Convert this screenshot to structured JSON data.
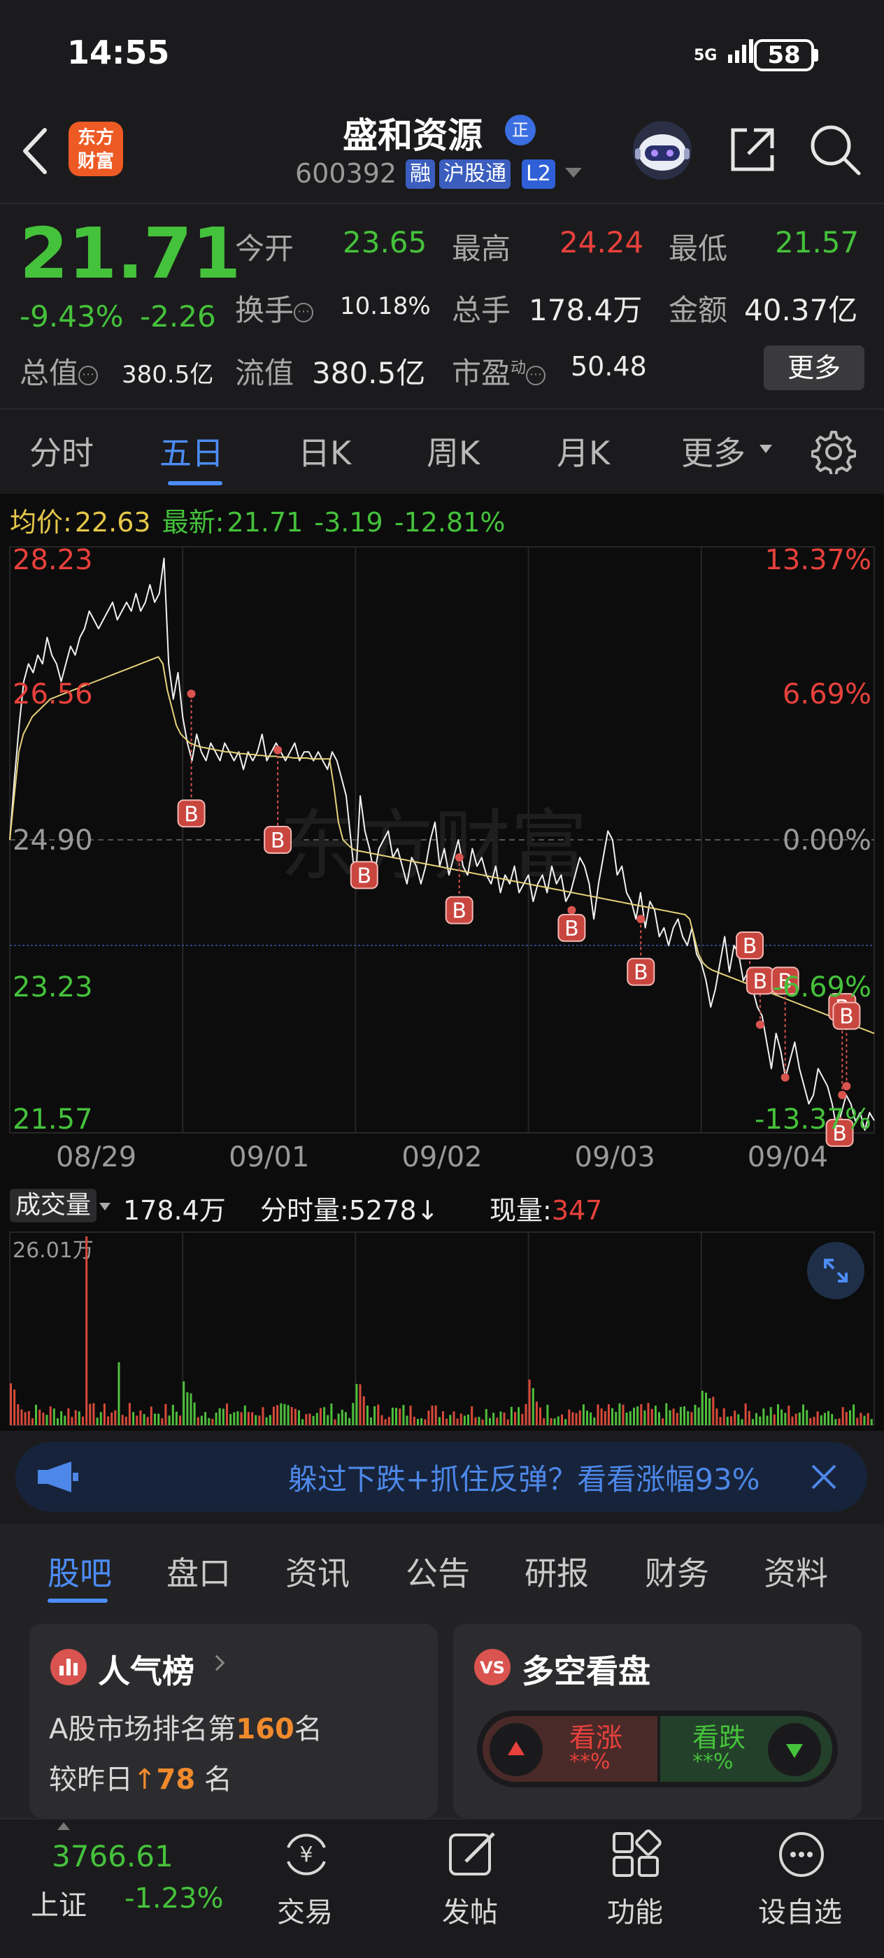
{
  "status_bar": {
    "time": "14:55",
    "network": "5G",
    "battery": "58"
  },
  "header": {
    "logo_line1": "东方",
    "logo_line2": "财富",
    "stock_name": "盛和资源",
    "name_badge": "正",
    "stock_code": "600392",
    "tags": [
      "融",
      "沪股通",
      "L2"
    ]
  },
  "quote": {
    "price": "21.71",
    "change_pct": "-9.43%",
    "change_val": "-2.26",
    "fields": {
      "open_label": "今开",
      "open": "23.65",
      "high_label": "最高",
      "high": "24.24",
      "low_label": "最低",
      "low": "21.57",
      "turnover_label": "换手",
      "turnover": "10.18%",
      "volume_label": "总手",
      "volume": "178.4万",
      "amount_label": "金额",
      "amount": "40.37亿",
      "mktcap_label": "总值",
      "mktcap": "380.5亿",
      "float_label": "流值",
      "float": "380.5亿",
      "pe_label": "市盈",
      "pe_sup": "动",
      "pe": "50.48"
    },
    "more_button": "更多"
  },
  "chart_tabs": [
    "分时",
    "五日",
    "日K",
    "周K",
    "月K",
    "更多"
  ],
  "active_tab": "五日",
  "info_line": {
    "avg_label": "均价:",
    "avg": "22.63",
    "latest_label": "最新:",
    "latest": "21.71",
    "change": "-3.19",
    "change_pct": "-12.81%"
  },
  "chart_data": {
    "type": "line",
    "watermark": "东方财富",
    "y_ticks_left": [
      "28.23",
      "26.56",
      "24.90",
      "23.23",
      "21.57"
    ],
    "y_ticks_right": [
      "13.37%",
      "6.69%",
      "0.00%",
      "-6.69%",
      "-13.37%"
    ],
    "ylim": [
      21.57,
      28.23
    ],
    "prev_close": 24.9,
    "x_labels": [
      "08/29",
      "09/01",
      "09/02",
      "09/03",
      "09/04"
    ],
    "series": [
      {
        "values": [
          24.9,
          25.6,
          26.2,
          26.7,
          26.9,
          26.8,
          27.0,
          26.9,
          27.2,
          27.0,
          26.9,
          26.7,
          26.9,
          27.1,
          27.0,
          27.2,
          27.3,
          27.5,
          27.4,
          27.3,
          27.4,
          27.5,
          27.6,
          27.4,
          27.5,
          27.6,
          27.5,
          27.7,
          27.5,
          27.6,
          27.8,
          27.6,
          27.7,
          28.1,
          26.9,
          26.5,
          26.8,
          26.3,
          26.0,
          25.8,
          26.1,
          25.9,
          25.8,
          26.0,
          25.9,
          25.8,
          26.0,
          25.9,
          25.8,
          25.9,
          25.7,
          25.9,
          25.8,
          25.9,
          26.1,
          25.8,
          25.9,
          26.0,
          25.9,
          25.8,
          25.9,
          26.0,
          25.8,
          25.9,
          25.9,
          25.8,
          25.9,
          25.8,
          25.7,
          25.9,
          25.8,
          25.6,
          25.4,
          24.9,
          24.4,
          25.4,
          25.0,
          24.8,
          24.5,
          24.8,
          24.9,
          25.0,
          24.7,
          24.8,
          24.6,
          24.4,
          24.7,
          24.6,
          24.4,
          24.6,
          24.9,
          25.1,
          24.6,
          24.8,
          24.5,
          24.7,
          24.9,
          24.6,
          24.5,
          24.8,
          24.6,
          24.7,
          24.5,
          24.4,
          24.6,
          24.3,
          24.5,
          24.4,
          24.6,
          24.3,
          24.4,
          24.5,
          24.2,
          24.4,
          24.5,
          24.3,
          24.6,
          24.4,
          24.5,
          24.2,
          24.3,
          24.5,
          24.7,
          24.6,
          24.4,
          24.0,
          24.4,
          24.7,
          25.0,
          24.9,
          24.5,
          24.6,
          24.3,
          24.2,
          24.0,
          24.3,
          23.9,
          24.2,
          24.1,
          23.8,
          23.9,
          23.7,
          23.9,
          24.0,
          23.8,
          23.7,
          23.9,
          23.6,
          23.5,
          23.3,
          23.0,
          23.2,
          23.5,
          23.8,
          23.4,
          23.7,
          23.6,
          23.3,
          23.4,
          23.2,
          23.0,
          22.9,
          22.6,
          22.3,
          22.7,
          22.5,
          22.2,
          22.4,
          22.6,
          22.3,
          22.1,
          21.9,
          22.0,
          22.3,
          22.2,
          22.1,
          21.9,
          21.6,
          21.8,
          22.0,
          21.9,
          21.7,
          21.8,
          21.6,
          21.8,
          21.71
        ]
      },
      {
        "name": "均价",
        "values": [
          24.9,
          25.4,
          25.9,
          26.1,
          26.2,
          26.3,
          26.35,
          26.4,
          26.45,
          26.5,
          26.52,
          26.54,
          26.56,
          26.58,
          26.6,
          26.62,
          26.64,
          26.66,
          26.68,
          26.7,
          26.72,
          26.74,
          26.76,
          26.78,
          26.8,
          26.82,
          26.84,
          26.86,
          26.88,
          26.9,
          26.92,
          26.94,
          26.96,
          26.98,
          26.9,
          26.6,
          26.4,
          26.2,
          26.1,
          26.05,
          26.0,
          25.98,
          25.96,
          25.95,
          25.94,
          25.93,
          25.92,
          25.91,
          25.9,
          25.9,
          25.89,
          25.88,
          25.88,
          25.87,
          25.87,
          25.86,
          25.86,
          25.85,
          25.85,
          25.85,
          25.84,
          25.84,
          25.84,
          25.83,
          25.83,
          25.83,
          25.83,
          25.82,
          25.82,
          25.82,
          25.82,
          25.82,
          25.5,
          25.1,
          24.9,
          24.85,
          24.8,
          24.78,
          24.77,
          24.76,
          24.75,
          24.74,
          24.73,
          24.72,
          24.71,
          24.7,
          24.69,
          24.68,
          24.67,
          24.66,
          24.65,
          24.64,
          24.63,
          24.62,
          24.61,
          24.6,
          24.59,
          24.58,
          24.57,
          24.56,
          24.55,
          24.54,
          24.53,
          24.52,
          24.51,
          24.5,
          24.49,
          24.48,
          24.47,
          24.46,
          24.45,
          24.44,
          24.43,
          24.42,
          24.41,
          24.4,
          24.39,
          24.38,
          24.37,
          24.36,
          24.35,
          24.34,
          24.33,
          24.32,
          24.31,
          24.3,
          24.29,
          24.28,
          24.27,
          24.26,
          24.25,
          24.24,
          24.23,
          24.22,
          24.21,
          24.2,
          24.19,
          24.18,
          24.17,
          24.16,
          24.15,
          24.14,
          24.13,
          24.12,
          24.11,
          24.1,
          24.09,
          24.08,
          24.07,
          24.06,
          24.05,
          24.0,
          23.8,
          23.6,
          23.5,
          23.45,
          23.42,
          23.4,
          23.38,
          23.36,
          23.34,
          23.32,
          23.3,
          23.28,
          23.26,
          23.24,
          23.22,
          23.2,
          23.18,
          23.16,
          23.14,
          23.12,
          23.1,
          23.08,
          23.06,
          23.04,
          23.02,
          23.0,
          22.98,
          22.96,
          22.94,
          22.92,
          22.9,
          22.88,
          22.86,
          22.84,
          22.82,
          22.8,
          22.78,
          22.76,
          22.74,
          22.72,
          22.7
        ]
      }
    ],
    "markers": [
      {
        "label": "B",
        "x": 0.21,
        "y": 26.56
      },
      {
        "label": "B",
        "x": 0.31,
        "y": 25.92
      },
      {
        "label": "B",
        "x": 0.41,
        "y": 24.6
      },
      {
        "label": "B",
        "x": 0.52,
        "y": 24.7
      },
      {
        "label": "B",
        "x": 0.65,
        "y": 24.1
      },
      {
        "label": "B",
        "x": 0.73,
        "y": 24.0
      },
      {
        "label": "B",
        "x": 0.856,
        "y": 23.3
      },
      {
        "label": "B",
        "x": 0.868,
        "y": 22.8
      },
      {
        "label": "B",
        "x": 0.897,
        "y": 22.2
      },
      {
        "label": "B",
        "x": 0.96,
        "y": 21.7
      },
      {
        "label": "B",
        "x": 0.963,
        "y": 22.0
      },
      {
        "label": "B",
        "x": 0.968,
        "y": 22.1
      }
    ],
    "markers_box_y": [
      25.2,
      24.9,
      24.5,
      24.1,
      23.9,
      23.4,
      23.7,
      23.3,
      23.3,
      21.57,
      23.0,
      22.9
    ],
    "volume": {
      "label": "成交量",
      "total": "178.4万",
      "fen_label": "分时量:",
      "fen": "5278↓",
      "cur_label": "现量:",
      "cur": "347",
      "max_tick": "26.01万"
    }
  },
  "banner": {
    "text": "躲过下跌+抓住反弹？看看涨幅93%"
  },
  "section_tabs": [
    "股吧",
    "盘口",
    "资讯",
    "公告",
    "研报",
    "财务",
    "资料"
  ],
  "popularity": {
    "title": "人气榜",
    "rank_prefix": "A股市场排名第",
    "rank": "160",
    "rank_suffix": "名",
    "change_prefix": "较昨日",
    "change": "78",
    "change_suffix": " 名"
  },
  "vs": {
    "title": "多空看盘",
    "bull_label": "看涨",
    "bull_pct": "**%",
    "bear_label": "看跌",
    "bear_pct": "**%"
  },
  "bottom_nav": {
    "index_value": "3766.61",
    "index_name": "上证",
    "index_pct": "-1.23%",
    "items": [
      "交易",
      "发帖",
      "功能",
      "设自选"
    ]
  }
}
